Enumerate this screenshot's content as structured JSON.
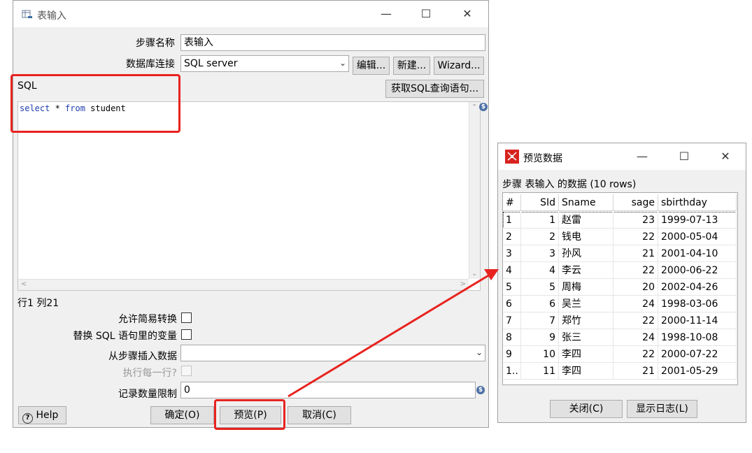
{
  "main_window": {
    "title": "表输入",
    "step_name_label": "步骤名称",
    "step_name_value": "表输入",
    "db_conn_label": "数据库连接",
    "db_conn_value": "SQL server",
    "edit_button": "编辑...",
    "new_button": "新建...",
    "wizard_button": "Wizard...",
    "sql_label": "SQL",
    "get_sql_button": "获取SQL查询语句...",
    "sql_code": {
      "kw1": "select",
      "mid": " * ",
      "kw2": "from",
      "tail": " student"
    },
    "cursor_pos": "行1 列21",
    "lazy_conversion_label": "允许简易转换",
    "replace_vars_label": "替换 SQL 语句里的变量",
    "insert_from_step_label": "从步骤插入数据",
    "execute_each_row_label": "执行每一行?",
    "limit_label": "记录数量限制",
    "limit_value": "0",
    "help_button": "Help",
    "ok_button": "确定(O)",
    "preview_button": "预览(P)",
    "cancel_button": "取消(C)"
  },
  "preview_window": {
    "title": "预览数据",
    "summary": "步骤 表输入 的数据  (10 rows)",
    "columns": [
      "#",
      "SId",
      "Sname",
      "sage",
      "sbirthday"
    ],
    "rows": [
      [
        "1",
        "1",
        "赵雷",
        "23",
        "1999-07-13"
      ],
      [
        "2",
        "2",
        "钱电",
        "22",
        "2000-05-04"
      ],
      [
        "3",
        "3",
        "孙风",
        "21",
        "2001-04-10"
      ],
      [
        "4",
        "4",
        "李云",
        "22",
        "2000-06-22"
      ],
      [
        "5",
        "5",
        "周梅",
        "20",
        "2002-04-26"
      ],
      [
        "6",
        "6",
        "吴兰",
        "24",
        "1998-03-06"
      ],
      [
        "7",
        "7",
        "郑竹",
        "22",
        "2000-11-14"
      ],
      [
        "8",
        "9",
        "张三",
        "24",
        "1998-10-08"
      ],
      [
        "9",
        "10",
        "李四",
        "22",
        "2000-07-22"
      ],
      [
        "1..",
        "11",
        "李四",
        "21",
        "2001-05-29"
      ]
    ],
    "close_button": "关闭(C)",
    "show_log_button": "显示日志(L)"
  },
  "colors": {
    "annotation_red": "#e8231f",
    "keyword_blue": "#1e3cae"
  }
}
